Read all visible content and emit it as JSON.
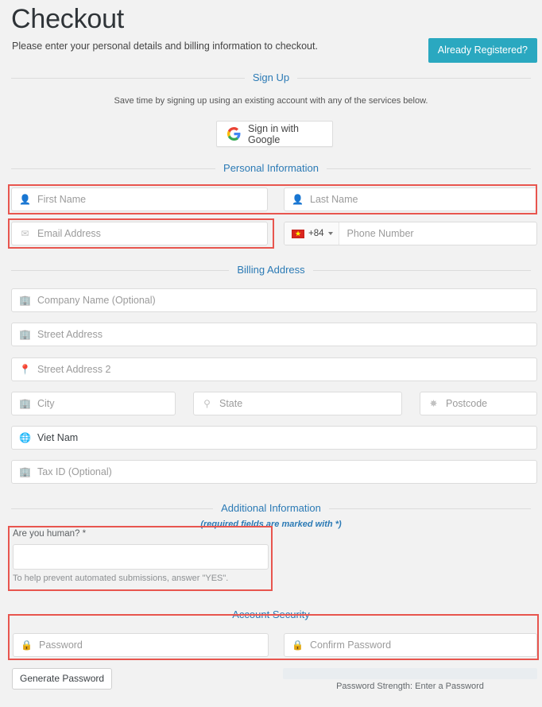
{
  "header": {
    "title": "Checkout",
    "subtitle": "Please enter your personal details and billing information to checkout.",
    "registered_button": "Already Registered?"
  },
  "signup": {
    "heading": "Sign Up",
    "note": "Save time by signing up using an existing account with any of the services below.",
    "google_button": "Sign in with Google"
  },
  "personal": {
    "heading": "Personal Information",
    "first_name": {
      "placeholder": "First Name",
      "icon": "user-icon"
    },
    "last_name": {
      "placeholder": "Last Name",
      "icon": "user-icon"
    },
    "email": {
      "placeholder": "Email Address",
      "icon": "envelope-icon"
    },
    "phone": {
      "country_code": "+84",
      "flag": "vietnam-flag",
      "placeholder": "Phone Number"
    }
  },
  "billing": {
    "heading": "Billing Address",
    "company": {
      "placeholder": "Company Name (Optional)",
      "icon": "building-icon"
    },
    "street1": {
      "placeholder": "Street Address",
      "icon": "building-icon"
    },
    "street2": {
      "placeholder": "Street Address 2",
      "icon": "map-marker-icon"
    },
    "city": {
      "placeholder": "City",
      "icon": "building-icon"
    },
    "state": {
      "placeholder": "State",
      "icon": "map-signs-icon"
    },
    "postcode": {
      "placeholder": "Postcode",
      "icon": "certificate-icon"
    },
    "country": {
      "value": "Viet Nam",
      "icon": "globe-icon"
    },
    "tax_id": {
      "placeholder": "Tax ID (Optional)",
      "icon": "building-icon"
    }
  },
  "additional": {
    "heading": "Additional Information",
    "required_note": "(required fields are marked with *)",
    "human_label": "Are you human? *",
    "human_value": "",
    "human_help": "To help prevent automated submissions, answer \"YES\"."
  },
  "security": {
    "heading": "Account Security",
    "password": {
      "placeholder": "Password",
      "icon": "lock-icon"
    },
    "confirm_password": {
      "placeholder": "Confirm Password",
      "icon": "lock-icon"
    },
    "generate_button": "Generate Password",
    "strength_text": "Password Strength: Enter a Password",
    "strength_percent": 0
  },
  "colors": {
    "accent_teal": "#2aa8c0",
    "heading_blue": "#2b7ab5",
    "error_red": "#e8554e",
    "page_background": "#f2f2f2",
    "field_border": "#dcdcdc"
  }
}
